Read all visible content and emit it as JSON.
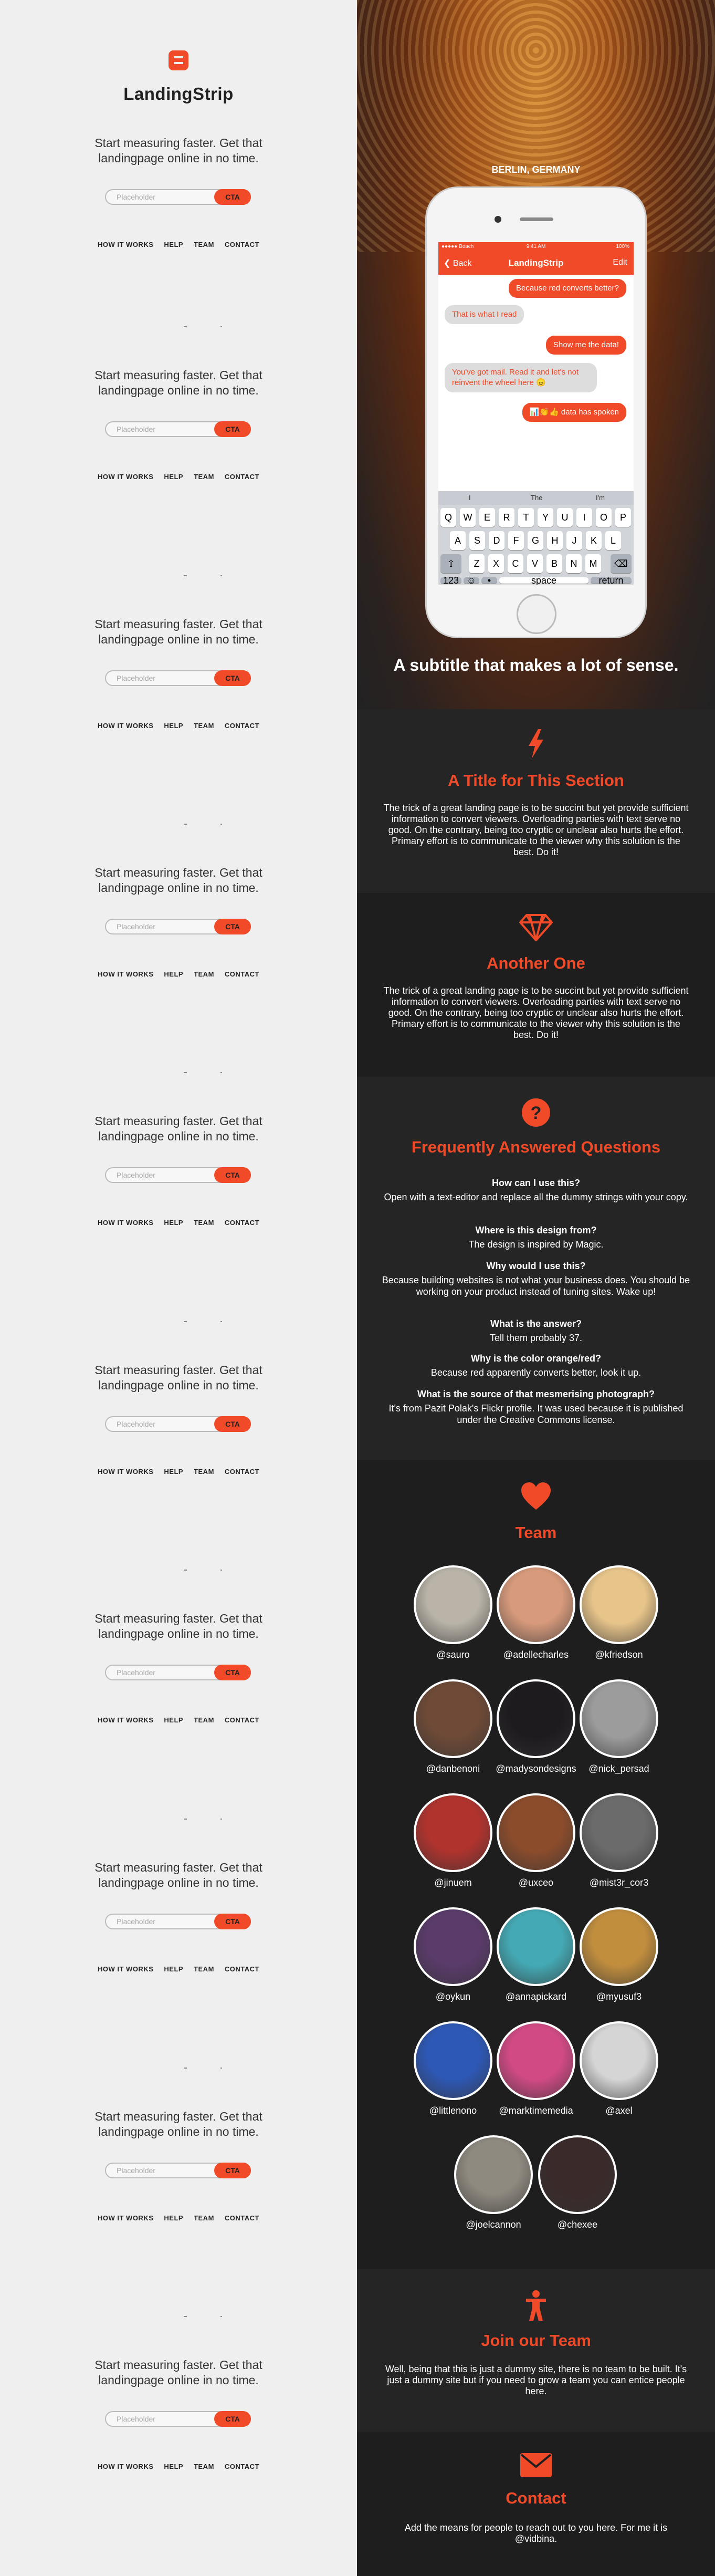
{
  "brand": {
    "name": "LandingStrip",
    "accent": "#f04a29"
  },
  "signup": {
    "tagline_line1": "Start measuring faster. Get that",
    "tagline_line2": "landingpage online in no time.",
    "placeholder": "Placeholder",
    "cta": "CTA",
    "nav": [
      "HOW IT WORKS",
      "HELP",
      "TEAM",
      "CONTACT"
    ]
  },
  "hero": {
    "location": "BERLIN, GERMANY",
    "subtitle": "A subtitle that makes a lot of sense."
  },
  "phone": {
    "status_left": "●●●●● Beach",
    "status_time": "9:41 AM",
    "status_right": "100%",
    "back": "Back",
    "title": "LandingStrip",
    "edit": "Edit",
    "messages": [
      {
        "dir": "out",
        "text": "Because red converts better?"
      },
      {
        "dir": "in",
        "text": "That is what I read"
      },
      {
        "dir": "out",
        "text": "Show me the data!"
      },
      {
        "dir": "in",
        "text": "You've got mail. Read it and let's not reinvent the wheel here 😠"
      },
      {
        "dir": "out",
        "text": "📊👏👍 data has spoken"
      }
    ],
    "suggestions": [
      "I",
      "The",
      "I'm"
    ],
    "keys_row1": [
      "Q",
      "W",
      "E",
      "R",
      "T",
      "Y",
      "U",
      "I",
      "O",
      "P"
    ],
    "keys_row2": [
      "A",
      "S",
      "D",
      "F",
      "G",
      "H",
      "J",
      "K",
      "L"
    ],
    "keys_row3": [
      "Z",
      "X",
      "C",
      "V",
      "B",
      "N",
      "M"
    ],
    "key_123": "123",
    "key_space": "space",
    "key_return": "return"
  },
  "sections": {
    "s1": {
      "title": "A Title for This Section",
      "text": "The trick of a great landing page is to be succint but yet provide sufficient information to convert viewers. Overloading parties with text serve no good. On the contrary, being too cryptic or unclear also hurts the effort. Primary effort is to communicate to the viewer why this solution is the best. Do it!"
    },
    "s2": {
      "title": "Another One",
      "text": "The trick of a great landing page is to be succint but yet provide sufficient information to convert viewers. Overloading parties with text serve no good. On the contrary, being too cryptic or unclear also hurts the effort. Primary effort is to communicate to the viewer why this solution is the best. Do it!"
    },
    "faq": {
      "title": "Frequently Answered Questions",
      "items": [
        {
          "q": "How can I use this?",
          "a": "Open with a text-editor and replace all the dummy strings with your copy."
        },
        {
          "q": "Where is this design from?",
          "a": "The design is inspired by Magic."
        },
        {
          "q": "Why would I use this?",
          "a": "Because building websites is not what your business does. You should be working on your product instead of tuning sites. Wake up!"
        },
        {
          "q": "What is the answer?",
          "a": "Tell them probably 37."
        },
        {
          "q": "Why is the color orange/red?",
          "a": "Because red apparently converts better, look it up."
        },
        {
          "q": "What is the source of that mesmerising photograph?",
          "a": "It's from Pazit Polak's Flickr profile. It was used because it is published under the Creative Commons license."
        }
      ]
    },
    "team": {
      "title": "Team",
      "members": [
        {
          "handle": "@sauro",
          "color": "#b9b3a8"
        },
        {
          "handle": "@adellecharles",
          "color": "#d79a7c"
        },
        {
          "handle": "@kfriedson",
          "color": "#e7c48a"
        },
        {
          "handle": "@danbenoni",
          "color": "#6e4a37"
        },
        {
          "handle": "@madysondesigns",
          "color": "#1e1b1e"
        },
        {
          "handle": "@nick_persad",
          "color": "#9c9c9c"
        },
        {
          "handle": "@jinuem",
          "color": "#b0332e"
        },
        {
          "handle": "@uxceo",
          "color": "#8b4c2c"
        },
        {
          "handle": "@mist3r_cor3",
          "color": "#6b6b6b"
        },
        {
          "handle": "@oykun",
          "color": "#5a3b6a"
        },
        {
          "handle": "@annapickard",
          "color": "#44a9b4"
        },
        {
          "handle": "@myusuf3",
          "color": "#c18e3e"
        },
        {
          "handle": "@littlenono",
          "color": "#2e58b5"
        },
        {
          "handle": "@marktimemedia",
          "color": "#d14a84"
        },
        {
          "handle": "@axel",
          "color": "#d5d5d5"
        },
        {
          "handle": "@joelcannon",
          "color": "#8f8a80"
        },
        {
          "handle": "@chexee",
          "color": "#3a2a2a"
        }
      ]
    },
    "join": {
      "title": "Join our Team",
      "text": "Well, being that this is just a dummy site, there is no team to be built. It's just a dummy site but if you need to grow a team you can entice people here."
    },
    "contact": {
      "title": "Contact",
      "text": "Add the means for people to reach out to you here. For me it is @vidbina."
    }
  }
}
